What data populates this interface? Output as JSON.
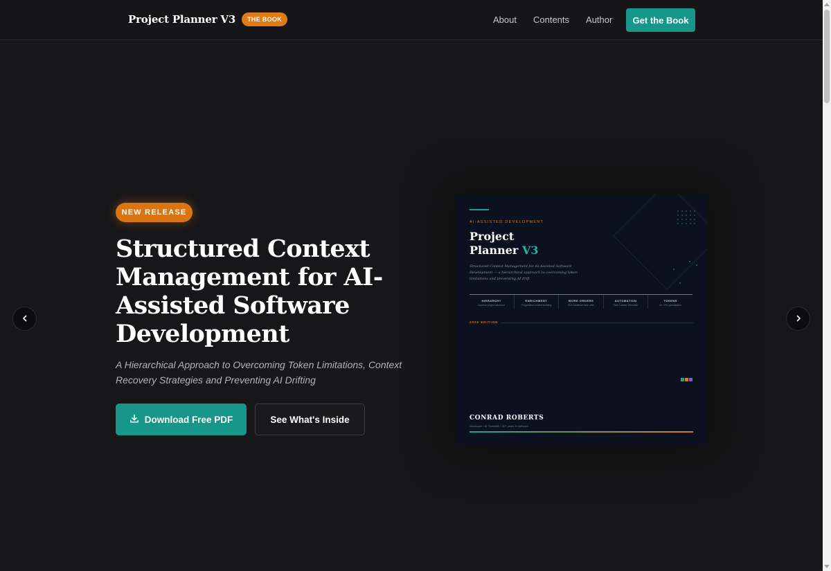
{
  "nav": {
    "brand": "Project Planner V3",
    "badge": "THE BOOK",
    "links": [
      "About",
      "Contents",
      "Author"
    ],
    "cta": "Get the Book"
  },
  "hero": {
    "pill": "NEW RELEASE",
    "headline": "Structured Context Management for AI-Assisted Software Development",
    "subtitle": "A Hierarchical Approach to Overcoming Token Limitations, Context Recovery Strategies and Preventing AI Drifting",
    "primary_button": "Download Free PDF",
    "secondary_button": "See What's Inside"
  },
  "cover": {
    "kicker": "AI-ASSISTED DEVELOPMENT",
    "title_line1": "Project",
    "title_line2": "Planner",
    "title_version": "V3",
    "description": "Structured Context Management for AI-Assisted Software Development — a hierarchical approach to overcoming token limitations and preventing AI drift",
    "pillars": [
      {
        "title": "HIERARCHY",
        "sub": "Layered project structure"
      },
      {
        "title": "ENRICHMENT",
        "sub": "Progressive context building"
      },
      {
        "title": "WORK ORDERS",
        "sub": "Self-contained task units"
      },
      {
        "title": "AUTOMATION",
        "sub": "Task Tracker execution"
      },
      {
        "title": "TOKENS",
        "sub": "50-70% optimization"
      }
    ],
    "edition": "2026 EDITION",
    "author": "CONRAD ROBERTS",
    "author_sub": "Developer • AI Toolsmith • 30+ years in software",
    "accent_colors": [
      "#17a394",
      "#e07b16",
      "#7b5fd6"
    ]
  },
  "colors": {
    "teal": "#16978a",
    "orange": "#d97512",
    "background": "#171719"
  }
}
